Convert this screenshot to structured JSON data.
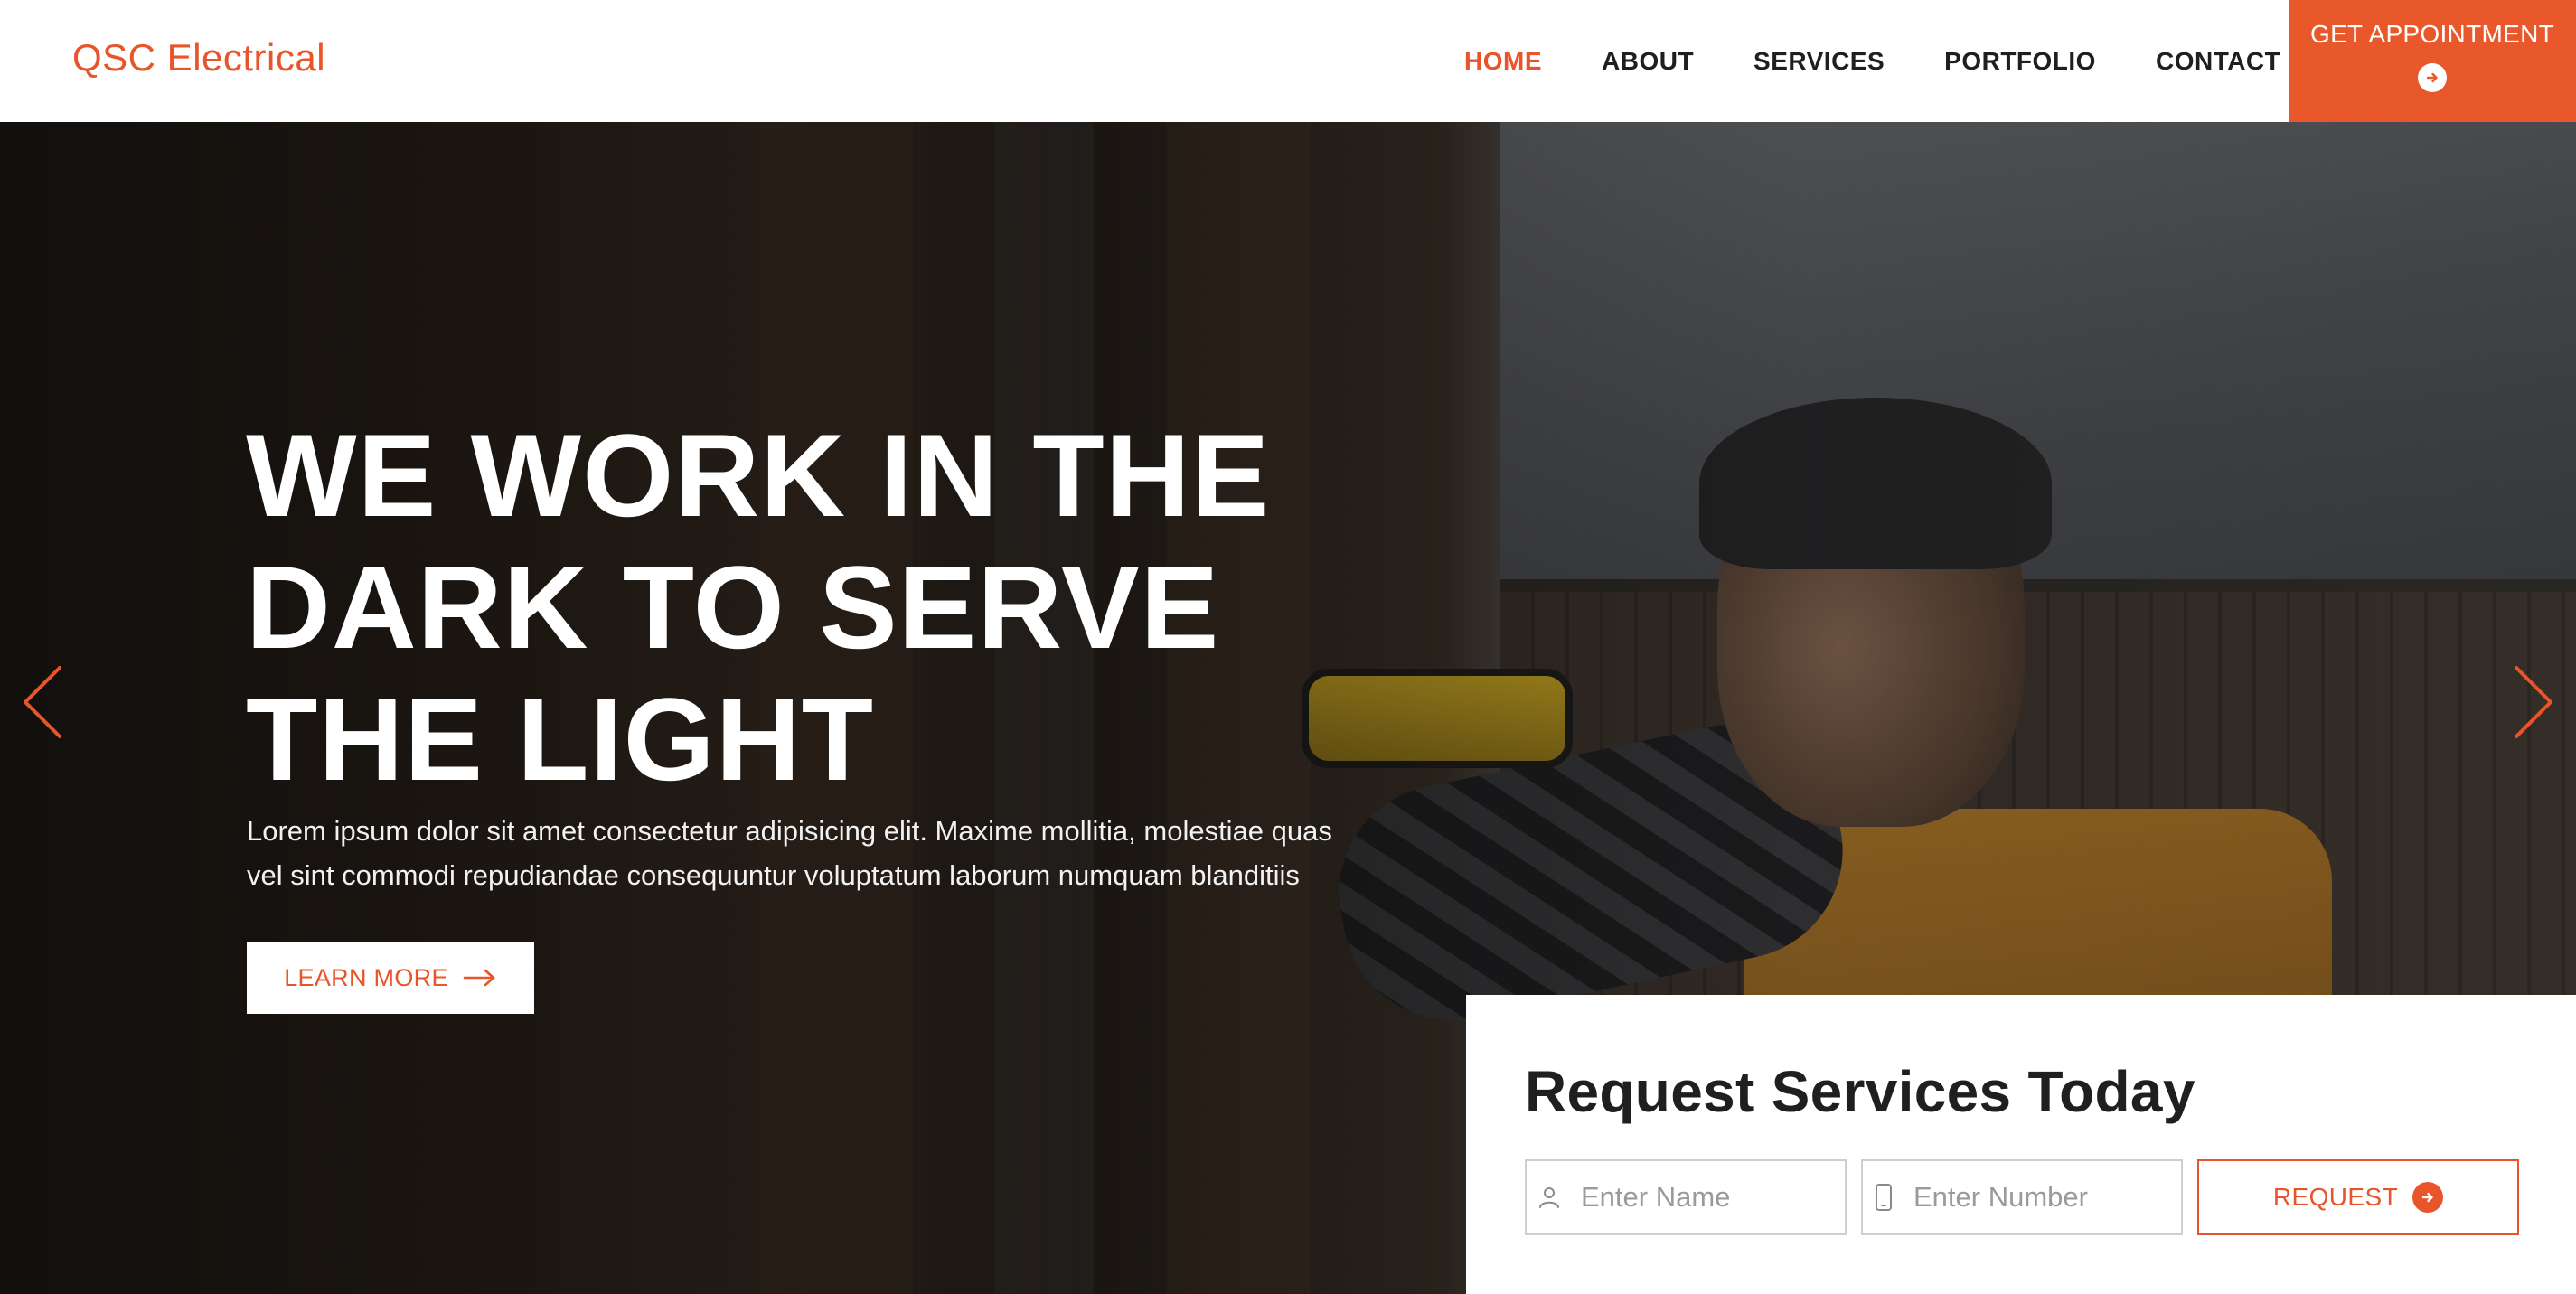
{
  "brand": {
    "name": "QSC Electrical",
    "accent": "#e8552a"
  },
  "nav": {
    "items": [
      {
        "label": "HOME",
        "active": true
      },
      {
        "label": "ABOUT",
        "active": false
      },
      {
        "label": "SERVICES",
        "active": false
      },
      {
        "label": "PORTFOLIO",
        "active": false
      },
      {
        "label": "CONTACT",
        "active": false
      }
    ],
    "cta_label": "GET APPOINTMENT",
    "cta_icon": "arrow-right-circle-icon"
  },
  "hero": {
    "title": "WE WORK IN THE DARK TO SERVE THE LIGHT",
    "text": "Lorem ipsum dolor sit amet consectetur adipisicing elit. Maxime mollitia, molestiae quas vel sint commodi repudiandae consequuntur voluptatum laborum numquam blanditiis",
    "button_label": "LEARN MORE",
    "button_icon": "arrow-right-icon",
    "prev_icon": "chevron-left-icon",
    "next_icon": "chevron-right-icon"
  },
  "request": {
    "title": "Request Services Today",
    "name_placeholder": "Enter Name",
    "name_icon": "user-icon",
    "number_placeholder": "Enter Number",
    "number_icon": "phone-icon",
    "button_label": "REQUEST",
    "button_icon": "arrow-right-circle-icon"
  }
}
